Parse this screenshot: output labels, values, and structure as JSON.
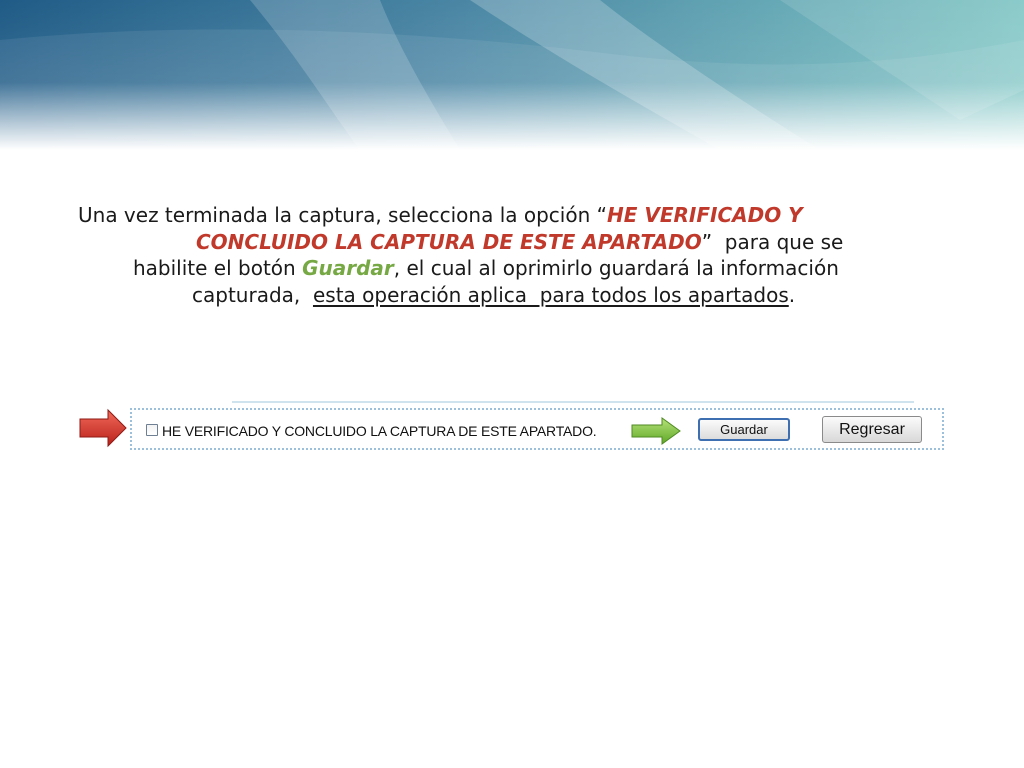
{
  "instructions": {
    "l1_pre": "Una vez terminada la captura, selecciona la opción “",
    "l1_em": "HE VERIFICADO Y",
    "l2_em": "CONCLUIDO LA CAPTURA DE ESTE APARTADO",
    "l2_post": "”  para que se",
    "l3_pre": "habilite el botón ",
    "l3_em": "Guardar",
    "l3_post": ", el cual al oprimirlo guardará la información",
    "l4_pre": "capturada,  ",
    "l4_ul": "esta operación aplica  para todos los apartados",
    "l4_post": "."
  },
  "form": {
    "checkbox_label": "HE VERIFICADO Y CONCLUIDO LA CAPTURA DE ESTE APARTADO.",
    "checkbox_checked": false,
    "save_button": "Guardar",
    "back_button": "Regresar"
  },
  "colors": {
    "emphasis_red": "#c0392b",
    "emphasis_green": "#76a844",
    "arrow_red": "#d9322a",
    "arrow_green": "#7cc13e"
  },
  "icons": [
    "red-arrow-icon",
    "green-arrow-icon"
  ]
}
